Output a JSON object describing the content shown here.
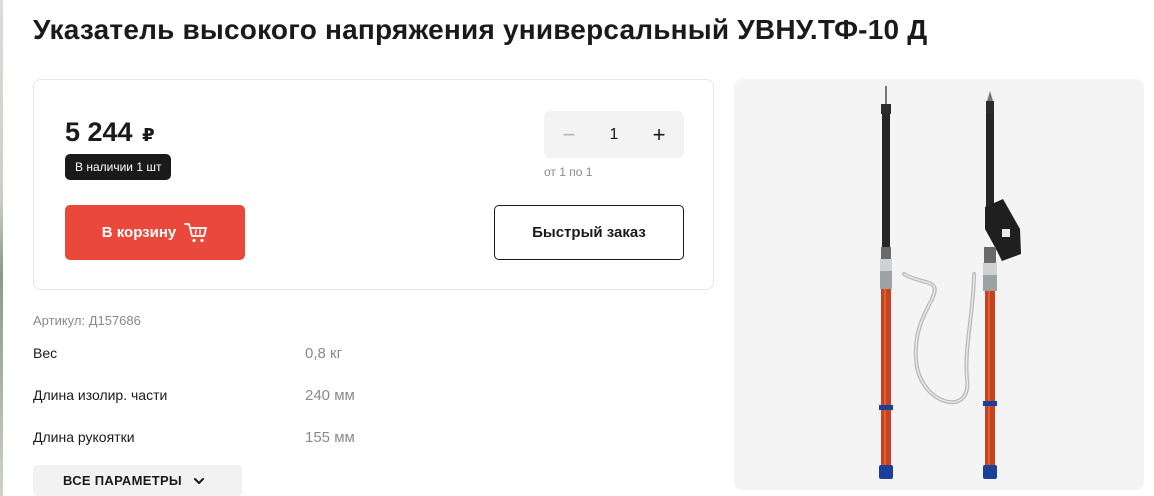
{
  "page": {
    "title": "Указатель высокого напряжения универсальный УВНУ.ТФ-10 Д"
  },
  "buy_box": {
    "price": "5 244",
    "currency": "₽",
    "stock": "В наличии 1 шт",
    "quantity": {
      "minus": "−",
      "value": "1",
      "plus": "+",
      "range": "от 1 по 1"
    },
    "cart_button": "В корзину",
    "quick_order_button": "Быстрый заказ"
  },
  "specs": {
    "sku": "Артикул: Д157686",
    "rows": [
      {
        "label": "Вес",
        "value": "0,8 кг"
      },
      {
        "label": "Длина изолир. части",
        "value": "240 мм"
      },
      {
        "label": "Длина рукоятки",
        "value": "155 мм"
      }
    ],
    "all_params_button": "ВСЕ ПАРАМЕТРЫ"
  },
  "colors": {
    "accent": "#e9483a",
    "dark": "#1a1a1a",
    "muted": "#8a8a8a",
    "pole_red": "#c8421e",
    "cap_blue": "#1c3f9a"
  },
  "icons": {
    "cart": "cart-icon",
    "chevron": "chevron-down-icon"
  }
}
